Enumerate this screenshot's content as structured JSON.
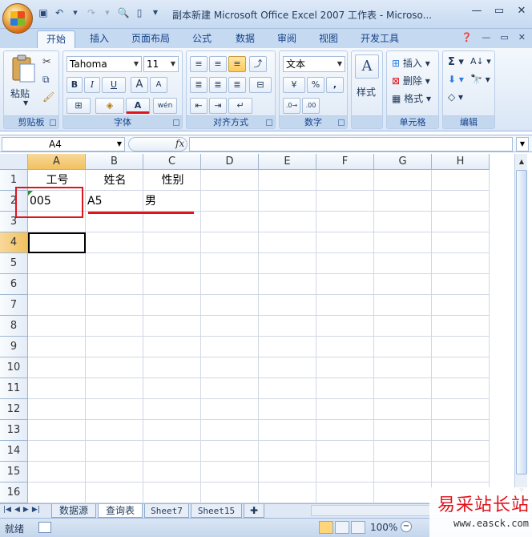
{
  "window": {
    "title": "副本新建 Microsoft Office Excel 2007 工作表 - Microso...",
    "controls": [
      "minimize",
      "maximize",
      "close"
    ]
  },
  "qat": {
    "icons": [
      "save-icon",
      "undo-icon",
      "redo-icon",
      "print-preview-icon",
      "new-icon",
      "customize-icon"
    ]
  },
  "tabs": [
    "开始",
    "插入",
    "页面布局",
    "公式",
    "数据",
    "审阅",
    "视图",
    "开发工具"
  ],
  "ribbon": {
    "clipboard": {
      "label": "剪贴板",
      "paste": "粘贴"
    },
    "font": {
      "label": "字体",
      "name": "Tahoma",
      "size": "11",
      "bold": "B",
      "italic": "I",
      "underline": "U",
      "grow": "A",
      "shrink": "A",
      "color_glyph": "A",
      "phonetic": "wén"
    },
    "alignment": {
      "label": "对齐方式"
    },
    "number": {
      "label": "数字",
      "format": "文本",
      "percent": "%",
      "comma": ","
    },
    "styles": {
      "label": "样式",
      "glyph": "A"
    },
    "cells": {
      "label": "单元格",
      "insert": "插入",
      "delete": "删除",
      "format": "格式"
    },
    "editing": {
      "label": "编辑",
      "sum": "Σ"
    }
  },
  "formula_bar": {
    "name_box": "A4",
    "fx": "fx",
    "content": ""
  },
  "columns": [
    "A",
    "B",
    "C",
    "D",
    "E",
    "F",
    "G",
    "H"
  ],
  "rows": [
    "1",
    "2",
    "3",
    "4",
    "5",
    "6",
    "7",
    "8",
    "9",
    "10",
    "11",
    "12",
    "13",
    "14",
    "15",
    "16"
  ],
  "cells": {
    "A1": "工号",
    "B1": "姓名",
    "C1": "性别",
    "A2": "005",
    "B2": "A5",
    "C2": "男"
  },
  "selected_cell": "A4",
  "sheets": [
    "数据源",
    "查询表",
    "Sheet7",
    "Sheet15"
  ],
  "active_sheet": "查询表",
  "status": {
    "text": "就绪",
    "zoom": "100%"
  },
  "watermark": {
    "cn": "易采站长站",
    "url": "www.easck.com"
  },
  "colors": {
    "accent": "#15428b",
    "highlight": "#e0141e",
    "selection": "#f1c15f"
  }
}
